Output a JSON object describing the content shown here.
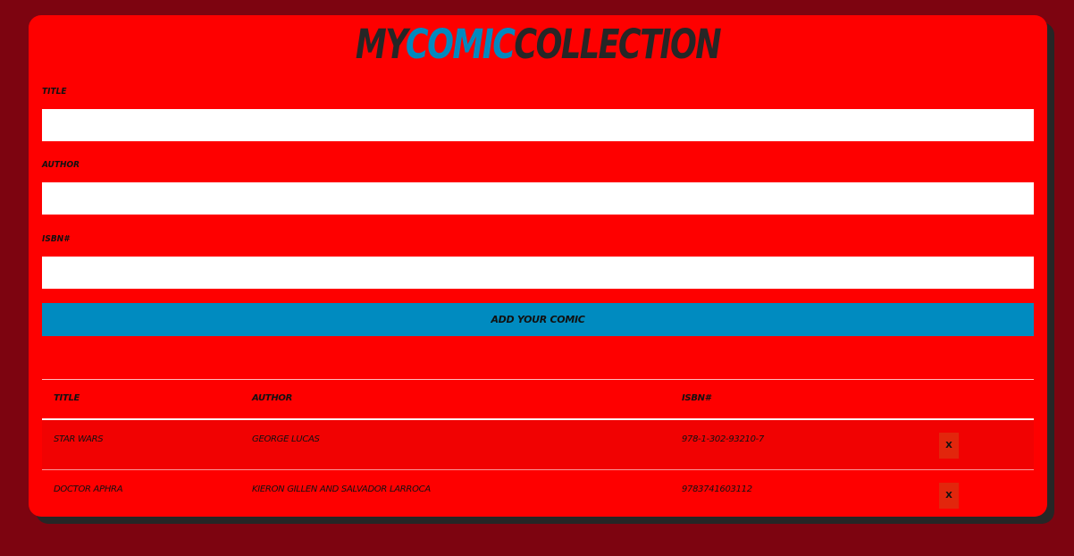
{
  "header": {
    "title_part1": "My",
    "title_part2": "Comic",
    "title_part3": "Collection"
  },
  "form": {
    "title_label": "Title",
    "author_label": "Author",
    "isbn_label": "ISBN#",
    "title_value": "",
    "author_value": "",
    "isbn_value": "",
    "submit_label": "Add Your Comic"
  },
  "table": {
    "headers": [
      "Title",
      "Author",
      "ISBN#"
    ],
    "rows": [
      {
        "title": "Star Wars",
        "author": "George Lucas",
        "isbn": "978-1-302-93210-7",
        "delete_label": "X"
      },
      {
        "title": "Doctor Aphra",
        "author": "Kieron Gillen and Salvador Larroca",
        "isbn": "9783741603112",
        "delete_label": "X"
      }
    ]
  },
  "colors": {
    "page_background": "#7d0410",
    "card_background": "#fe0000",
    "accent": "#0089bf",
    "title_dark": "#262626",
    "delete_button": "#e2260c"
  }
}
